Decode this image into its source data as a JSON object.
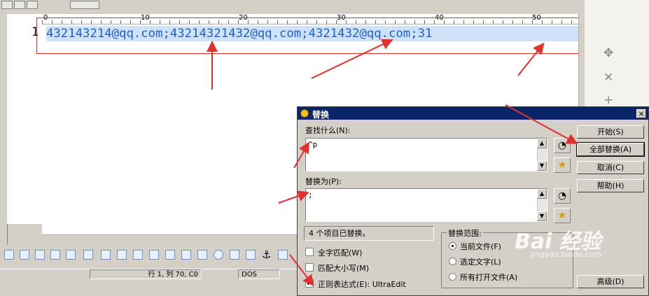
{
  "editor": {
    "line_number": "1",
    "line_text": "432143214@qq.com;43214321432@qq.com;4321432@qq.com;31",
    "ruler_labels": [
      "0",
      "10",
      "20",
      "30",
      "40",
      "50"
    ]
  },
  "status_bar": {
    "position": "行 1, 列 70, C0",
    "format": "DOS"
  },
  "dialog": {
    "title": "替换",
    "close_symbol": "×",
    "find_label": "查找什么(N):",
    "find_value": "^p",
    "replace_label": "替换为(P):",
    "replace_value": ";",
    "status": "4 个项目已替换。",
    "buttons": {
      "start": "开始(S)",
      "replace_all": "全部替换(A)",
      "cancel": "取消(C)",
      "help": "帮助(H)",
      "advanced": "高级(D)"
    },
    "options": {
      "match_word": "全字匹配(W)",
      "match_case": "匹配大小写(M)",
      "regex": "正则表达式(E): UltraEdit",
      "regex_checked": true
    },
    "scope": {
      "label": "替换范围:",
      "current_file": "当前文件(F)",
      "selected_text": "选定文字(L)",
      "all_open": "所有打开文件(A)",
      "selected": "current_file"
    }
  },
  "watermark": {
    "brand": "Bai 经验",
    "sub": "jingyan.baidu.com"
  },
  "colors": {
    "accent_title": "#0a246a",
    "annotation": "#e03030",
    "text_blue": "#1e5fd6"
  }
}
